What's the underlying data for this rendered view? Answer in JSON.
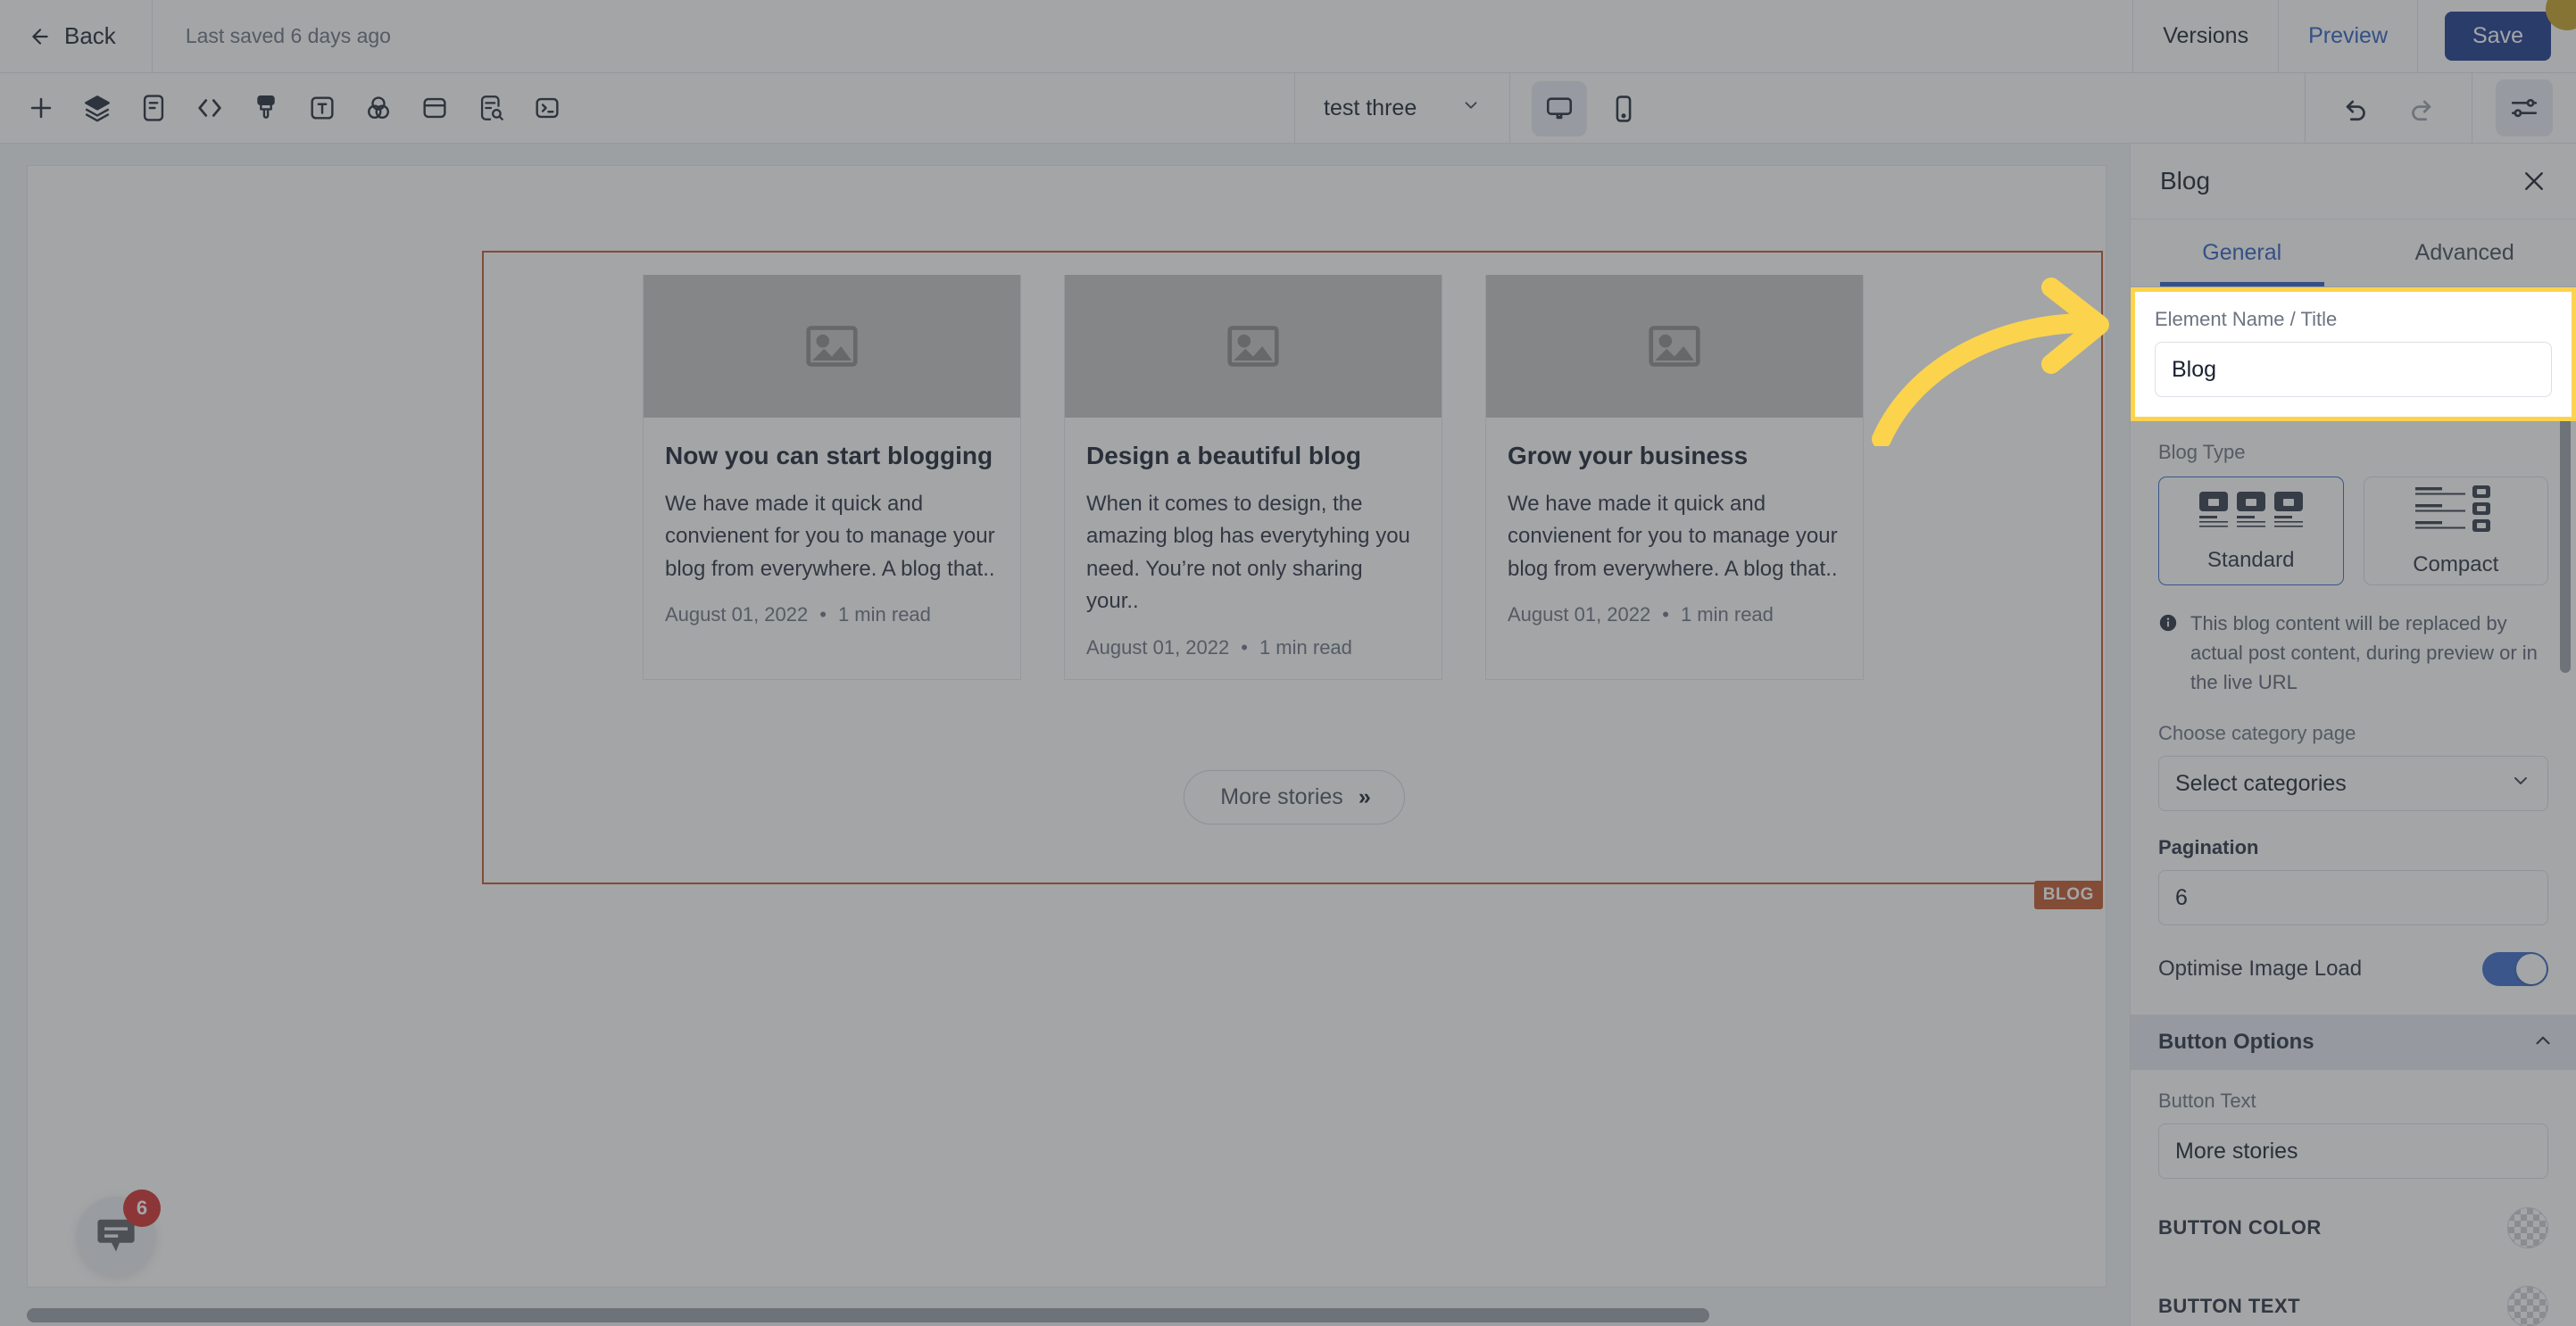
{
  "header": {
    "back_label": "Back",
    "last_saved": "Last saved 6 days ago",
    "versions_label": "Versions",
    "preview_label": "Preview",
    "save_label": "Save"
  },
  "toolbar": {
    "icons": [
      {
        "name": "add-icon",
        "title": "Add"
      },
      {
        "name": "layers-icon",
        "title": "Layers"
      },
      {
        "name": "page-icon",
        "title": "Pages"
      },
      {
        "name": "code-icon",
        "title": "Code"
      },
      {
        "name": "brush-icon",
        "title": "Theme"
      },
      {
        "name": "text-icon",
        "title": "Typography"
      },
      {
        "name": "color-blend-icon",
        "title": "Colors"
      },
      {
        "name": "card-icon",
        "title": "Layout"
      },
      {
        "name": "page-search-icon",
        "title": "SEO"
      },
      {
        "name": "terminal-icon",
        "title": "Console"
      }
    ],
    "page_selector": "test three",
    "device_desktop": "desktop-icon",
    "device_mobile": "mobile-icon",
    "undo": "undo-icon",
    "redo": "redo-icon",
    "settings": "sliders-icon"
  },
  "canvas": {
    "section_tag": "BLOG",
    "cards": [
      {
        "title": "Now you can start blogging",
        "excerpt": "We have made it quick and convienent for you to manage your blog from everywhere. A blog that..",
        "date": "August 01, 2022",
        "read_time": "1 min read"
      },
      {
        "title": "Design a beautiful blog",
        "excerpt": "When it comes to design, the amazing blog has everytyhing you need. You’re not only sharing your..",
        "date": "August 01, 2022",
        "read_time": "1 min read"
      },
      {
        "title": "Grow your business",
        "excerpt": "We have made it quick and convienent for you to manage your blog from everywhere. A blog that..",
        "date": "August 01, 2022",
        "read_time": "1 min read"
      }
    ],
    "more_button": "More stories",
    "more_chevron": "»",
    "chat_badge": "6"
  },
  "panel": {
    "title": "Blog",
    "close": "close-icon",
    "tabs": [
      {
        "label": "General",
        "active": true
      },
      {
        "label": "Advanced",
        "active": false
      }
    ],
    "element_name": {
      "label": "Element Name / Title",
      "value": "Blog"
    },
    "blog_type": {
      "label": "Blog Type",
      "options": [
        {
          "label": "Standard",
          "selected": true
        },
        {
          "label": "Compact",
          "selected": false
        }
      ]
    },
    "info_note": "This blog content will be replaced by actual post content, during preview or in the live URL",
    "category": {
      "label": "Choose category page",
      "value": "Select categories"
    },
    "pagination": {
      "label": "Pagination",
      "value": "6"
    },
    "optimise_image_load": {
      "label": "Optimise Image Load",
      "state": "on"
    },
    "button_options": {
      "header": "Button Options",
      "button_text_label": "Button Text",
      "button_text_value": "More stories",
      "button_color_label": "BUTTON COLOR",
      "button_text_color_label": "BUTTON TEXT"
    }
  },
  "colors": {
    "accent_blue": "#2f5fbf",
    "save_blue": "#1b3a8c",
    "highlight_yellow": "#fbd34d",
    "selection_orange": "#c0572a",
    "badge_red": "#d32f2f",
    "gold_dot": "#c9a227"
  }
}
